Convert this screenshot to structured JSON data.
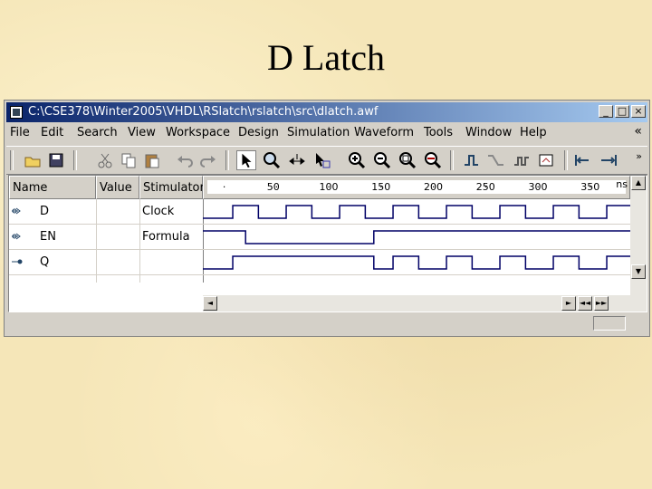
{
  "slide": {
    "title": "D Latch"
  },
  "window": {
    "title": "C:\\CSE378\\Winter2005\\VHDL\\RSlatch\\rslatch\\src\\dlatch.awf",
    "buttons": {
      "minimize": "_",
      "maximize": "□",
      "close": "×"
    }
  },
  "menu": {
    "items": [
      "File",
      "Edit",
      "Search",
      "View",
      "Workspace",
      "Design",
      "Simulation",
      "Waveform",
      "Tools",
      "Window",
      "Help"
    ],
    "overflow": "«"
  },
  "toolbar": {
    "icons": [
      "open-folder-icon",
      "save-icon",
      "cut-icon",
      "copy-icon",
      "paste-icon",
      "undo-icon",
      "redo-icon",
      "pointer-icon",
      "zoom-icon",
      "measure-icon",
      "select-icon",
      "zoom-in-icon",
      "zoom-out-icon",
      "zoom-fit-icon",
      "zoom-area-icon",
      "edge-next-icon",
      "edge-prev-icon",
      "stimulator-icon",
      "export-icon",
      "snap-left-icon",
      "snap-right-icon"
    ],
    "overflow": "»"
  },
  "waveform": {
    "columns": {
      "name": "Name",
      "value": "Value",
      "stimulator": "Stimulator"
    },
    "ruler": {
      "unit": "ns",
      "labels": [
        {
          "t": 50,
          "text": "50"
        },
        {
          "t": 100,
          "text": "100"
        },
        {
          "t": 150,
          "text": "150"
        },
        {
          "t": 200,
          "text": "200"
        },
        {
          "t": 250,
          "text": "250"
        },
        {
          "t": 300,
          "text": "300"
        },
        {
          "t": 350,
          "text": "350"
        }
      ],
      "t_min": 0,
      "t_max": 400
    },
    "signals": [
      {
        "name": "D",
        "value": "",
        "stimulator": "Clock",
        "direction": "input",
        "transitions": [
          [
            0,
            0
          ],
          [
            28,
            1
          ],
          [
            52,
            0
          ],
          [
            78,
            1
          ],
          [
            102,
            0
          ],
          [
            128,
            1
          ],
          [
            152,
            0
          ],
          [
            178,
            1
          ],
          [
            202,
            0
          ],
          [
            228,
            1
          ],
          [
            252,
            0
          ],
          [
            278,
            1
          ],
          [
            302,
            0
          ],
          [
            328,
            1
          ],
          [
            352,
            0
          ],
          [
            378,
            1
          ],
          [
            400,
            1
          ]
        ]
      },
      {
        "name": "EN",
        "value": "",
        "stimulator": "Formula",
        "direction": "input",
        "transitions": [
          [
            0,
            1
          ],
          [
            40,
            0
          ],
          [
            160,
            1
          ],
          [
            400,
            1
          ]
        ]
      },
      {
        "name": "Q",
        "value": "",
        "stimulator": "",
        "direction": "output",
        "transitions": [
          [
            0,
            0
          ],
          [
            28,
            1
          ],
          [
            160,
            0
          ],
          [
            178,
            1
          ],
          [
            202,
            0
          ],
          [
            228,
            1
          ],
          [
            252,
            0
          ],
          [
            278,
            1
          ],
          [
            302,
            0
          ],
          [
            328,
            1
          ],
          [
            352,
            0
          ],
          [
            378,
            1
          ],
          [
            400,
            1
          ]
        ]
      }
    ]
  },
  "scroll": {
    "up": "▲",
    "down": "▼",
    "left": "◄",
    "right": "►",
    "first": "◄◄",
    "last": "►►"
  }
}
